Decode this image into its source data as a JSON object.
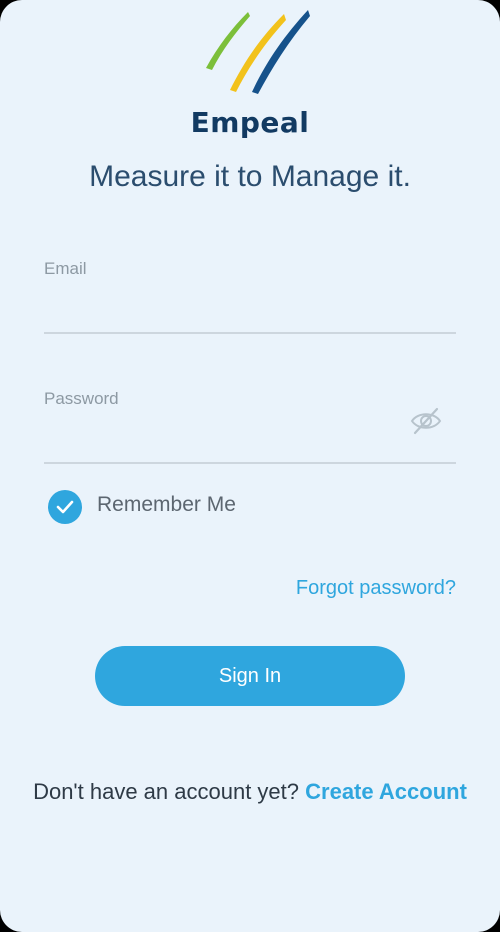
{
  "brand": {
    "name": "Empeal",
    "tagline": "Measure it to Manage it.",
    "logo_icon": "tri-stripe-logo-icon",
    "colors": {
      "green": "#7cbf3a",
      "yellow": "#f2c21b",
      "blue": "#16528b",
      "text": "#123a62"
    }
  },
  "form": {
    "email_label": "Email",
    "email_value": "",
    "password_label": "Password",
    "password_value": "",
    "password_toggle_icon": "eye-slash-icon",
    "remember_label": "Remember Me",
    "remember_checked": true,
    "forgot_label": "Forgot password?",
    "signin_label": "Sign In"
  },
  "footer": {
    "prompt": "Don't have an account yet?",
    "create_label": "Create Account"
  },
  "colors": {
    "accent": "#2fa6de",
    "background": "#eaf3fb"
  }
}
